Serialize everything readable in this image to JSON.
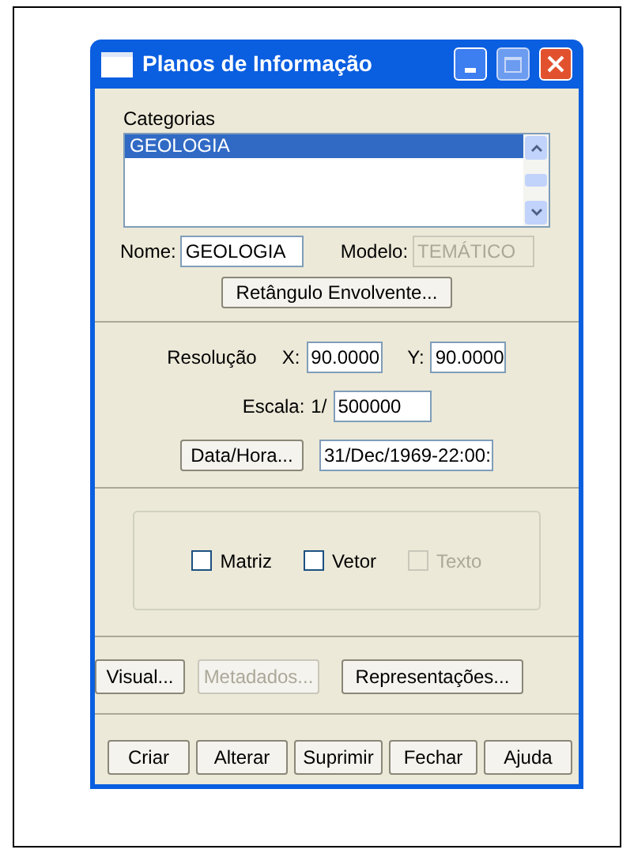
{
  "window": {
    "title": "Planos de Informação"
  },
  "categories": {
    "label": "Categorias",
    "items": [
      {
        "label": "GEOLOGIA",
        "selected": true
      }
    ]
  },
  "name_field": {
    "label": "Nome:",
    "value": "GEOLOGIA"
  },
  "model_field": {
    "label": "Modelo:",
    "value": "TEMÁTICO",
    "disabled": true
  },
  "bounding_button": {
    "label": "Retângulo Envolvente..."
  },
  "resolution": {
    "label": "Resolução",
    "x_label": "X:",
    "x_value": "90.0000",
    "y_label": "Y:",
    "y_value": "90.0000"
  },
  "scale": {
    "label": "Escala:",
    "prefix": "1/",
    "value": "500000"
  },
  "datetime": {
    "button": "Data/Hora...",
    "value": "31/Dec/1969-22:00:"
  },
  "checkboxes": [
    {
      "label": "Matriz",
      "checked": false,
      "disabled": false
    },
    {
      "label": "Vetor",
      "checked": false,
      "disabled": false
    },
    {
      "label": "Texto",
      "checked": false,
      "disabled": true
    }
  ],
  "middle_buttons": [
    {
      "label": "Visual...",
      "disabled": false
    },
    {
      "label": "Metadados...",
      "disabled": true
    },
    {
      "label": "Representações...",
      "disabled": false
    }
  ],
  "bottom_buttons": [
    {
      "label": "Criar",
      "disabled": false
    },
    {
      "label": "Alterar",
      "disabled": false
    },
    {
      "label": "Suprimir",
      "disabled": false
    },
    {
      "label": "Fechar",
      "disabled": false
    },
    {
      "label": "Ajuda",
      "disabled": false
    }
  ]
}
